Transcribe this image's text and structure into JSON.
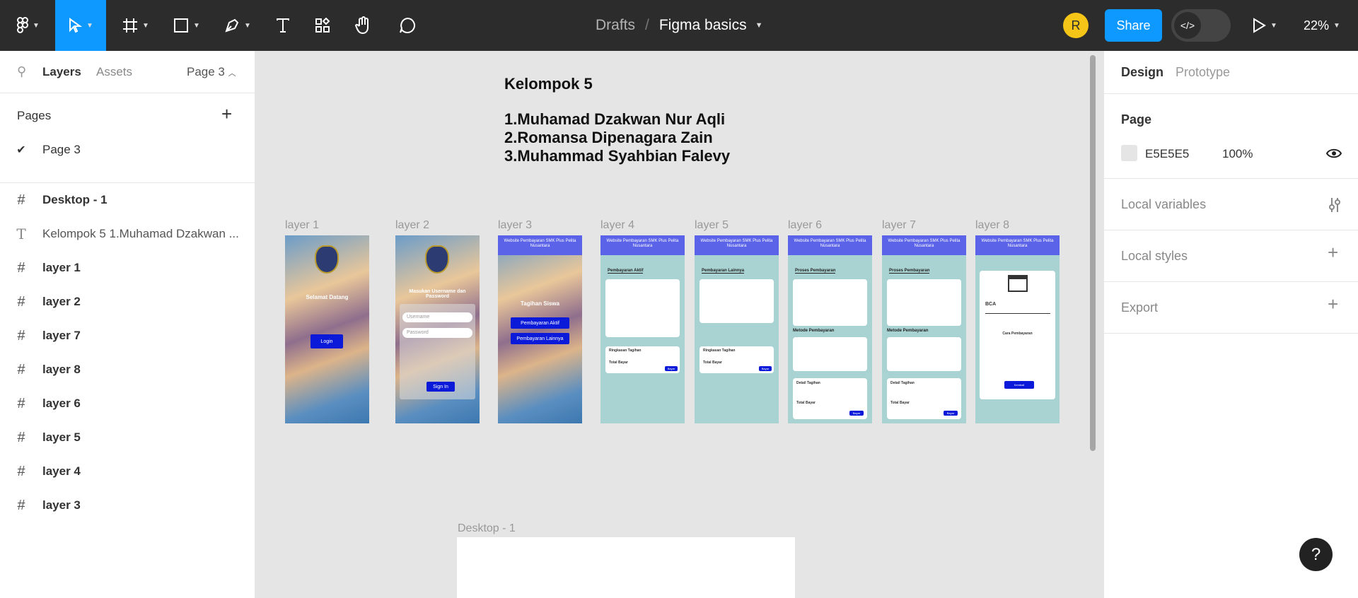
{
  "toolbar": {
    "title_drafts": "Drafts",
    "title_separator": "/",
    "title_file": "Figma basics",
    "avatar_initial": "R",
    "share_label": "Share",
    "zoom": "22%"
  },
  "left_panel": {
    "tab_layers": "Layers",
    "tab_assets": "Assets",
    "page_selector": "Page 3",
    "pages_heading": "Pages",
    "pages": [
      "Page 3"
    ],
    "layers": [
      {
        "name": "Desktop - 1",
        "icon": "frame-icon",
        "bold": true
      },
      {
        "name": "Kelompok 5 1.Muhamad Dzakwan ...",
        "icon": "text-icon",
        "bold": false
      },
      {
        "name": "layer 1",
        "icon": "frame-icon",
        "bold": true
      },
      {
        "name": "layer 2",
        "icon": "frame-icon",
        "bold": true
      },
      {
        "name": "layer 7",
        "icon": "frame-icon",
        "bold": true
      },
      {
        "name": "layer 8",
        "icon": "frame-icon",
        "bold": true
      },
      {
        "name": "layer 6",
        "icon": "frame-icon",
        "bold": true
      },
      {
        "name": "layer 5",
        "icon": "frame-icon",
        "bold": true
      },
      {
        "name": "layer 4",
        "icon": "frame-icon",
        "bold": true
      },
      {
        "name": "layer 3",
        "icon": "frame-icon",
        "bold": true
      }
    ]
  },
  "right_panel": {
    "tab_design": "Design",
    "tab_prototype": "Prototype",
    "page_heading": "Page",
    "page_color": "E5E5E5",
    "page_opacity": "100%",
    "local_variables": "Local variables",
    "local_styles": "Local styles",
    "export": "Export"
  },
  "canvas": {
    "text_heading": "Kelompok 5",
    "text_lines": [
      "1.Muhamad Dzakwan Nur Aqli",
      "2.Romansa Dipenagara Zain",
      "3.Muhammad Syahbian Falevy"
    ],
    "frame_labels": [
      "layer 1",
      "layer 2",
      "layer 3",
      "layer 4",
      "layer 5",
      "layer 6",
      "layer 7",
      "layer 8"
    ],
    "desktop_label": "Desktop - 1",
    "app_header": "Website Pembayaran SMK Plus Pelita Nusantara",
    "l1_welcome": "Selamat Datang",
    "l1_login": "Login",
    "l2_prompt": "Masukan Username dan Password",
    "l2_username": "Username",
    "l2_password": "Password",
    "l2_signin": "Sign In",
    "l3_title": "Tagihan Siswa",
    "l3_btn1": "Pembayaran Aktif",
    "l3_btn2": "Pembayaran Lainnya",
    "l4_title": "Pembayaran Aktif",
    "l5_title": "Pembayaran Lainnya",
    "l6_title": "Proses Pembayaran",
    "l7_title": "Proses Pembayaran",
    "l8_bank": "BCA",
    "l8_cara": "Cara Pembayaran",
    "l8_btn": "Kembali",
    "metode": "Metode Pembayaran",
    "ringkasan": "Ringkasan Tagihan",
    "detail": "Detail Tagihan",
    "bayar": "Bayar",
    "total": "Total Bayar"
  },
  "colors": {
    "toolbar_bg": "#2c2c2c",
    "accent": "#0d99ff",
    "canvas_bg": "#e5e5e5",
    "app_header": "#5b63e8",
    "app_button": "#0a1ad8"
  }
}
